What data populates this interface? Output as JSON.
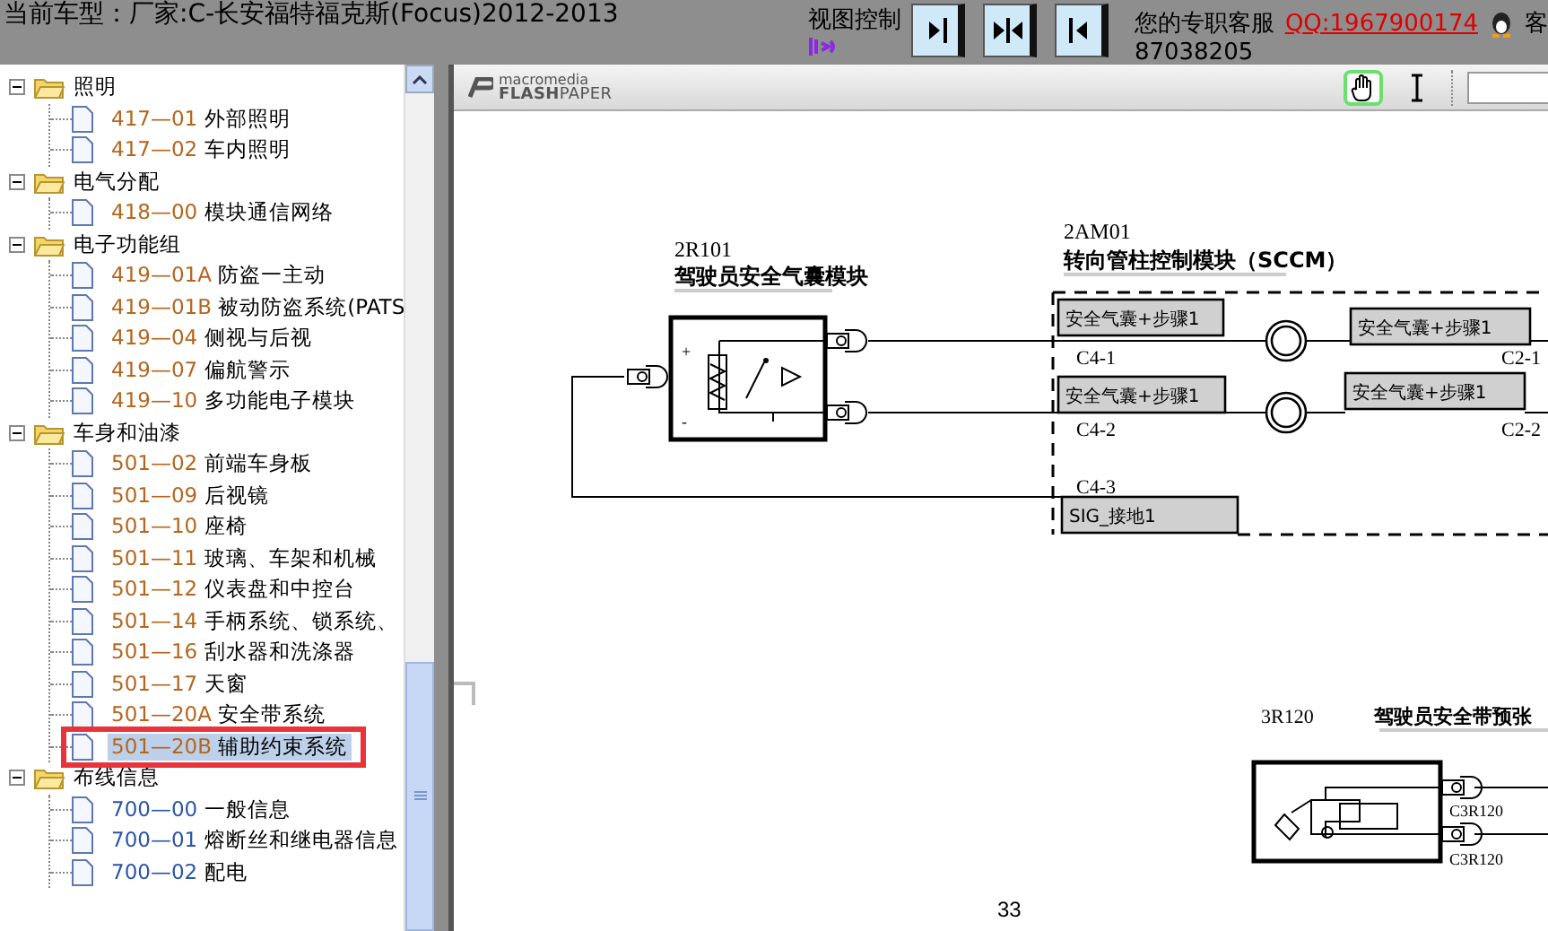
{
  "top_bar": {
    "title": "当前车型：厂家:C-长安福特福克斯(Focus)2012-2013",
    "view_control_label": "视图控制",
    "view_buttons": [
      {
        "kind": "right"
      },
      {
        "kind": "both"
      },
      {
        "kind": "left"
      }
    ],
    "service_label": "您的专职客服",
    "qq_link": "QQ:1967900174",
    "service_suffix": "客",
    "phone": "87038205"
  },
  "tree": [
    {
      "label": "照明",
      "expanded": true,
      "children": [
        {
          "code": "417—01",
          "name": "外部照明",
          "visited": true,
          "selected": false
        },
        {
          "code": "417—02",
          "name": "车内照明",
          "visited": true,
          "selected": false
        }
      ]
    },
    {
      "label": "电气分配",
      "expanded": true,
      "children": [
        {
          "code": "418—00",
          "name": "模块通信网络",
          "visited": true,
          "selected": false
        }
      ]
    },
    {
      "label": "电子功能组",
      "expanded": true,
      "children": [
        {
          "code": "419—01A",
          "name": "防盗一主动",
          "visited": true,
          "selected": false
        },
        {
          "code": "419—01B",
          "name": "被动防盗系统(PATS",
          "visited": true,
          "selected": false
        },
        {
          "code": "419—04",
          "name": "侧视与后视",
          "visited": true,
          "selected": false
        },
        {
          "code": "419—07",
          "name": "偏航警示",
          "visited": true,
          "selected": false
        },
        {
          "code": "419—10",
          "name": "多功能电子模块",
          "visited": true,
          "selected": false
        }
      ]
    },
    {
      "label": "车身和油漆",
      "expanded": true,
      "children": [
        {
          "code": "501—02",
          "name": "前端车身板",
          "visited": true,
          "selected": false
        },
        {
          "code": "501—09",
          "name": "后视镜",
          "visited": true,
          "selected": false
        },
        {
          "code": "501—10",
          "name": "座椅",
          "visited": true,
          "selected": false
        },
        {
          "code": "501—11",
          "name": "玻璃、车架和机械",
          "visited": true,
          "selected": false
        },
        {
          "code": "501—12",
          "name": "仪表盘和中控台",
          "visited": true,
          "selected": false
        },
        {
          "code": "501—14",
          "name": "手柄系统、锁系统、",
          "visited": true,
          "selected": false
        },
        {
          "code": "501—16",
          "name": "刮水器和洗涤器",
          "visited": true,
          "selected": false
        },
        {
          "code": "501—17",
          "name": "天窗",
          "visited": true,
          "selected": false
        },
        {
          "code": "501—20A",
          "name": "安全带系统",
          "visited": true,
          "selected": false
        },
        {
          "code": "501—20B",
          "name": "辅助约束系统",
          "visited": true,
          "selected": true
        }
      ]
    },
    {
      "label": "布线信息",
      "expanded": true,
      "children": [
        {
          "code": "700—00",
          "name": "一般信息",
          "visited": false,
          "selected": false
        },
        {
          "code": "700—01",
          "name": "熔断丝和继电器信息",
          "visited": false,
          "selected": false
        },
        {
          "code": "700—02",
          "name": "配电",
          "visited": false,
          "selected": false
        }
      ]
    }
  ],
  "viewer": {
    "logo_top": "macromedia",
    "logo_bottom": "**FLASH**PAPER",
    "tools": [
      {
        "kind": "hand",
        "selected": true
      },
      {
        "kind": "text",
        "selected": false
      }
    ]
  },
  "diagram": {
    "module_a": {
      "id": "2R101",
      "name": "驾驶员安全气囊模块",
      "plus": "+",
      "minus": "-"
    },
    "module_b": {
      "id": "2AM01",
      "name": "转向管柱控制模块（SCCM）"
    },
    "circuit_labels": [
      "安全气囊+步骤1",
      "安全气囊+步骤1",
      "安全气囊+步骤1",
      "安全气囊+步骤1",
      "SIG_接地1"
    ],
    "pins": [
      "C4-1",
      "C2-1",
      "C4-2",
      "C2-2",
      "C4-3"
    ],
    "module_c": {
      "id": "3R120",
      "name": "驾驶员安全带预张"
    },
    "connector_labels": [
      "C3R120",
      "C3R120"
    ],
    "page_number": "33"
  }
}
